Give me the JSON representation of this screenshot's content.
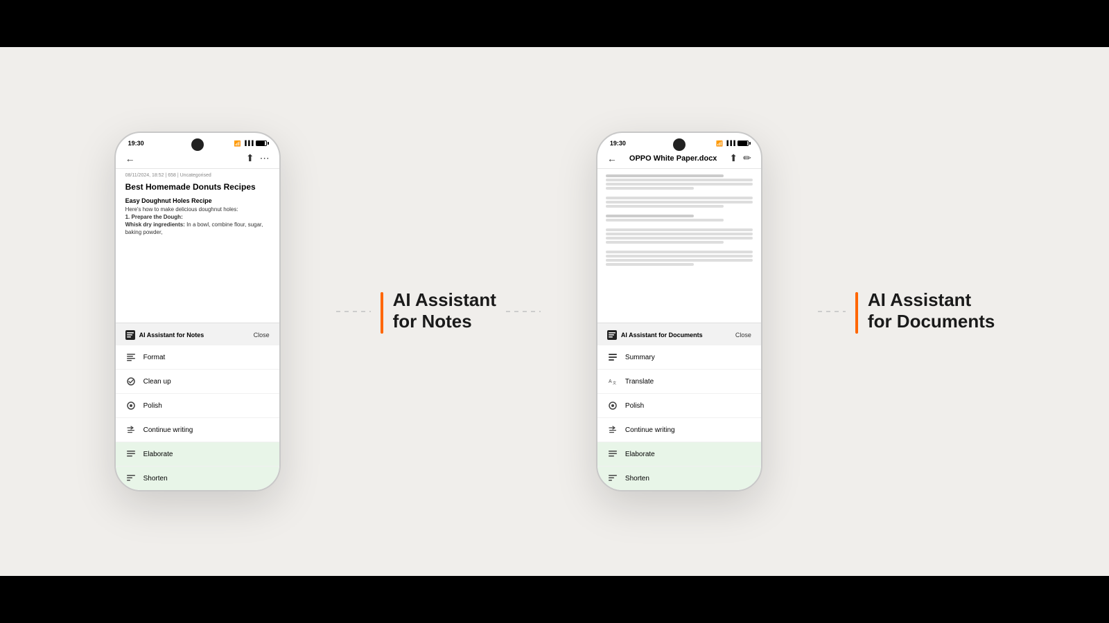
{
  "scene": {
    "bg_color": "#f0eeeb"
  },
  "phone1": {
    "status_time": "19:30",
    "nav_back_icon": "←",
    "nav_share_icon": "⬆",
    "nav_more_icon": "⋮",
    "note_meta": "08/11/2024, 18:52  |  658  |  Uncategorised",
    "note_title": "Best Homemade Donuts Recipes",
    "note_subtitle": "Easy Doughnut Holes Recipe",
    "note_body1": "Here's how to make delicious doughnut holes:",
    "note_body2": "1. Prepare the Dough:",
    "note_body3": "Whisk dry ingredients:",
    "note_body4": " In a bowl, combine flour, sugar, baking powder,",
    "ai_panel_title": "AI Assistant for Notes",
    "ai_close": "Close",
    "menu_items": [
      {
        "label": "Format",
        "icon": "format"
      },
      {
        "label": "Clean up",
        "icon": "cleanup"
      },
      {
        "label": "Polish",
        "icon": "polish"
      },
      {
        "label": "Continue writing",
        "icon": "write"
      },
      {
        "label": "Elaborate",
        "icon": "elaborate"
      },
      {
        "label": "Shorten",
        "icon": "shorten"
      }
    ]
  },
  "label1": {
    "title": "AI Assistant\nfor Notes"
  },
  "phone2": {
    "status_time": "19:30",
    "doc_title": "OPPO White Paper.docx",
    "nav_share_icon": "⬆",
    "nav_edit_icon": "✏",
    "ai_panel_title": "AI Assistant for Documents",
    "ai_close": "Close",
    "menu_items": [
      {
        "label": "Summary",
        "icon": "summary"
      },
      {
        "label": "Translate",
        "icon": "translate"
      },
      {
        "label": "Polish",
        "icon": "polish"
      },
      {
        "label": "Continue writing",
        "icon": "write"
      },
      {
        "label": "Elaborate",
        "icon": "elaborate"
      },
      {
        "label": "Shorten",
        "icon": "shorten"
      }
    ]
  },
  "label2": {
    "title": "AI Assistant\nfor Documents"
  }
}
